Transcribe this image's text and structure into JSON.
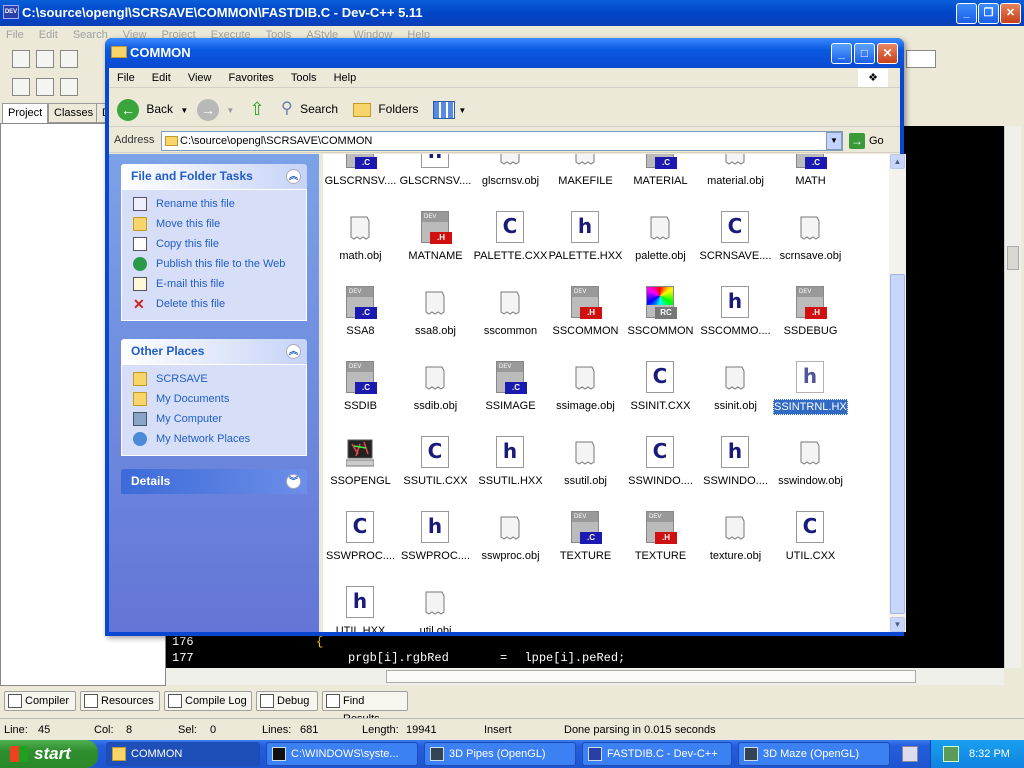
{
  "dev": {
    "title": "C:\\source\\opengl\\SCRSAVE\\COMMON\\FASTDIB.C - Dev-C++ 5.11",
    "app_icon_text": "DEV",
    "menu": [
      "File",
      "Edit",
      "Search",
      "View",
      "Project",
      "Execute",
      "Tools",
      "AStyle",
      "Window",
      "Help"
    ],
    "tabs": [
      "Project",
      "Classes",
      "D"
    ],
    "code": {
      "line_numbers": [
        "176",
        "177"
      ],
      "line1": "{",
      "line2_a": "prgb[i].rgbRed",
      "line2_op": "=",
      "line2_b": "lppe[i].peRed;"
    },
    "bottom_tabs": [
      "Compiler",
      "Resources",
      "Compile Log",
      "Debug",
      "Find Results"
    ],
    "status": {
      "line_label": "Line:",
      "line": "45",
      "col_label": "Col:",
      "col": "8",
      "sel_label": "Sel:",
      "sel": "0",
      "lines_label": "Lines:",
      "lines": "681",
      "length_label": "Length:",
      "length": "19941",
      "mode": "Insert",
      "message": "Done parsing in 0.015 seconds"
    }
  },
  "explorer": {
    "title": "COMMON",
    "menu": [
      "File",
      "Edit",
      "View",
      "Favorites",
      "Tools",
      "Help"
    ],
    "toolbar": {
      "back": "Back",
      "search": "Search",
      "folders": "Folders"
    },
    "address_label": "Address",
    "address": "C:\\source\\opengl\\SCRSAVE\\COMMON",
    "go": "Go",
    "file_tasks": {
      "title": "File and Folder Tasks",
      "items": [
        "Rename this file",
        "Move this file",
        "Copy this file",
        "Publish this file to the Web",
        "E-mail this file",
        "Delete this file"
      ]
    },
    "other_places": {
      "title": "Other Places",
      "items": [
        "SCRSAVE",
        "My Documents",
        "My Computer",
        "My Network Places"
      ]
    },
    "details": {
      "title": "Details"
    },
    "files": [
      {
        "name": "GLSCRNSV....",
        "type": "devc"
      },
      {
        "name": "GLSCRNSV....",
        "type": "h"
      },
      {
        "name": "glscrnsv.obj",
        "type": "obj"
      },
      {
        "name": "MAKEFILE",
        "type": "obj"
      },
      {
        "name": "MATERIAL",
        "type": "devc"
      },
      {
        "name": "material.obj",
        "type": "obj"
      },
      {
        "name": "MATH",
        "type": "devc"
      },
      {
        "name": "math.obj",
        "type": "obj"
      },
      {
        "name": "MATNAME",
        "type": "devh"
      },
      {
        "name": "PALETTE.CXX",
        "type": "c"
      },
      {
        "name": "PALETTE.HXX",
        "type": "h"
      },
      {
        "name": "palette.obj",
        "type": "obj"
      },
      {
        "name": "SCRNSAVE....",
        "type": "c"
      },
      {
        "name": "scrnsave.obj",
        "type": "obj"
      },
      {
        "name": "SSA8",
        "type": "devc"
      },
      {
        "name": "ssa8.obj",
        "type": "obj"
      },
      {
        "name": "sscommon",
        "type": "obj"
      },
      {
        "name": "SSCOMMON",
        "type": "devh"
      },
      {
        "name": "SSCOMMON",
        "type": "rc"
      },
      {
        "name": "SSCOMMO....",
        "type": "h"
      },
      {
        "name": "SSDEBUG",
        "type": "devh"
      },
      {
        "name": "SSDIB",
        "type": "devc"
      },
      {
        "name": "ssdib.obj",
        "type": "obj"
      },
      {
        "name": "SSIMAGE",
        "type": "devc"
      },
      {
        "name": "ssimage.obj",
        "type": "obj"
      },
      {
        "name": "SSINIT.CXX",
        "type": "c"
      },
      {
        "name": "ssinit.obj",
        "type": "obj"
      },
      {
        "name": "SSINTRNL.HXX",
        "type": "h",
        "selected": true
      },
      {
        "name": "SSOPENGL",
        "type": "exe"
      },
      {
        "name": "SSUTIL.CXX",
        "type": "c"
      },
      {
        "name": "SSUTIL.HXX",
        "type": "h"
      },
      {
        "name": "ssutil.obj",
        "type": "obj"
      },
      {
        "name": "SSWINDO....",
        "type": "c"
      },
      {
        "name": "SSWINDO....",
        "type": "h"
      },
      {
        "name": "sswindow.obj",
        "type": "obj"
      },
      {
        "name": "SSWPROC....",
        "type": "c"
      },
      {
        "name": "SSWPROC....",
        "type": "h"
      },
      {
        "name": "sswproc.obj",
        "type": "obj"
      },
      {
        "name": "TEXTURE",
        "type": "devc"
      },
      {
        "name": "TEXTURE",
        "type": "devh"
      },
      {
        "name": "texture.obj",
        "type": "obj"
      },
      {
        "name": "UTIL.CXX",
        "type": "c"
      },
      {
        "name": "UTIL.HXX",
        "type": "h"
      },
      {
        "name": "util.obj",
        "type": "obj"
      }
    ]
  },
  "taskbar": {
    "start": "start",
    "tasks": [
      "COMMON",
      "C:\\WINDOWS\\syste...",
      "3D Pipes (OpenGL)",
      "FASTDIB.C - Dev-C++",
      "3D Maze (OpenGL)"
    ],
    "clock": "8:32 PM"
  },
  "colors": {
    "xp_blue": "#0a47d0",
    "selection": "#316ac5",
    "task_link": "#215dc6",
    "taskbar": "#245edb",
    "start_green": "#2e8e2e"
  }
}
